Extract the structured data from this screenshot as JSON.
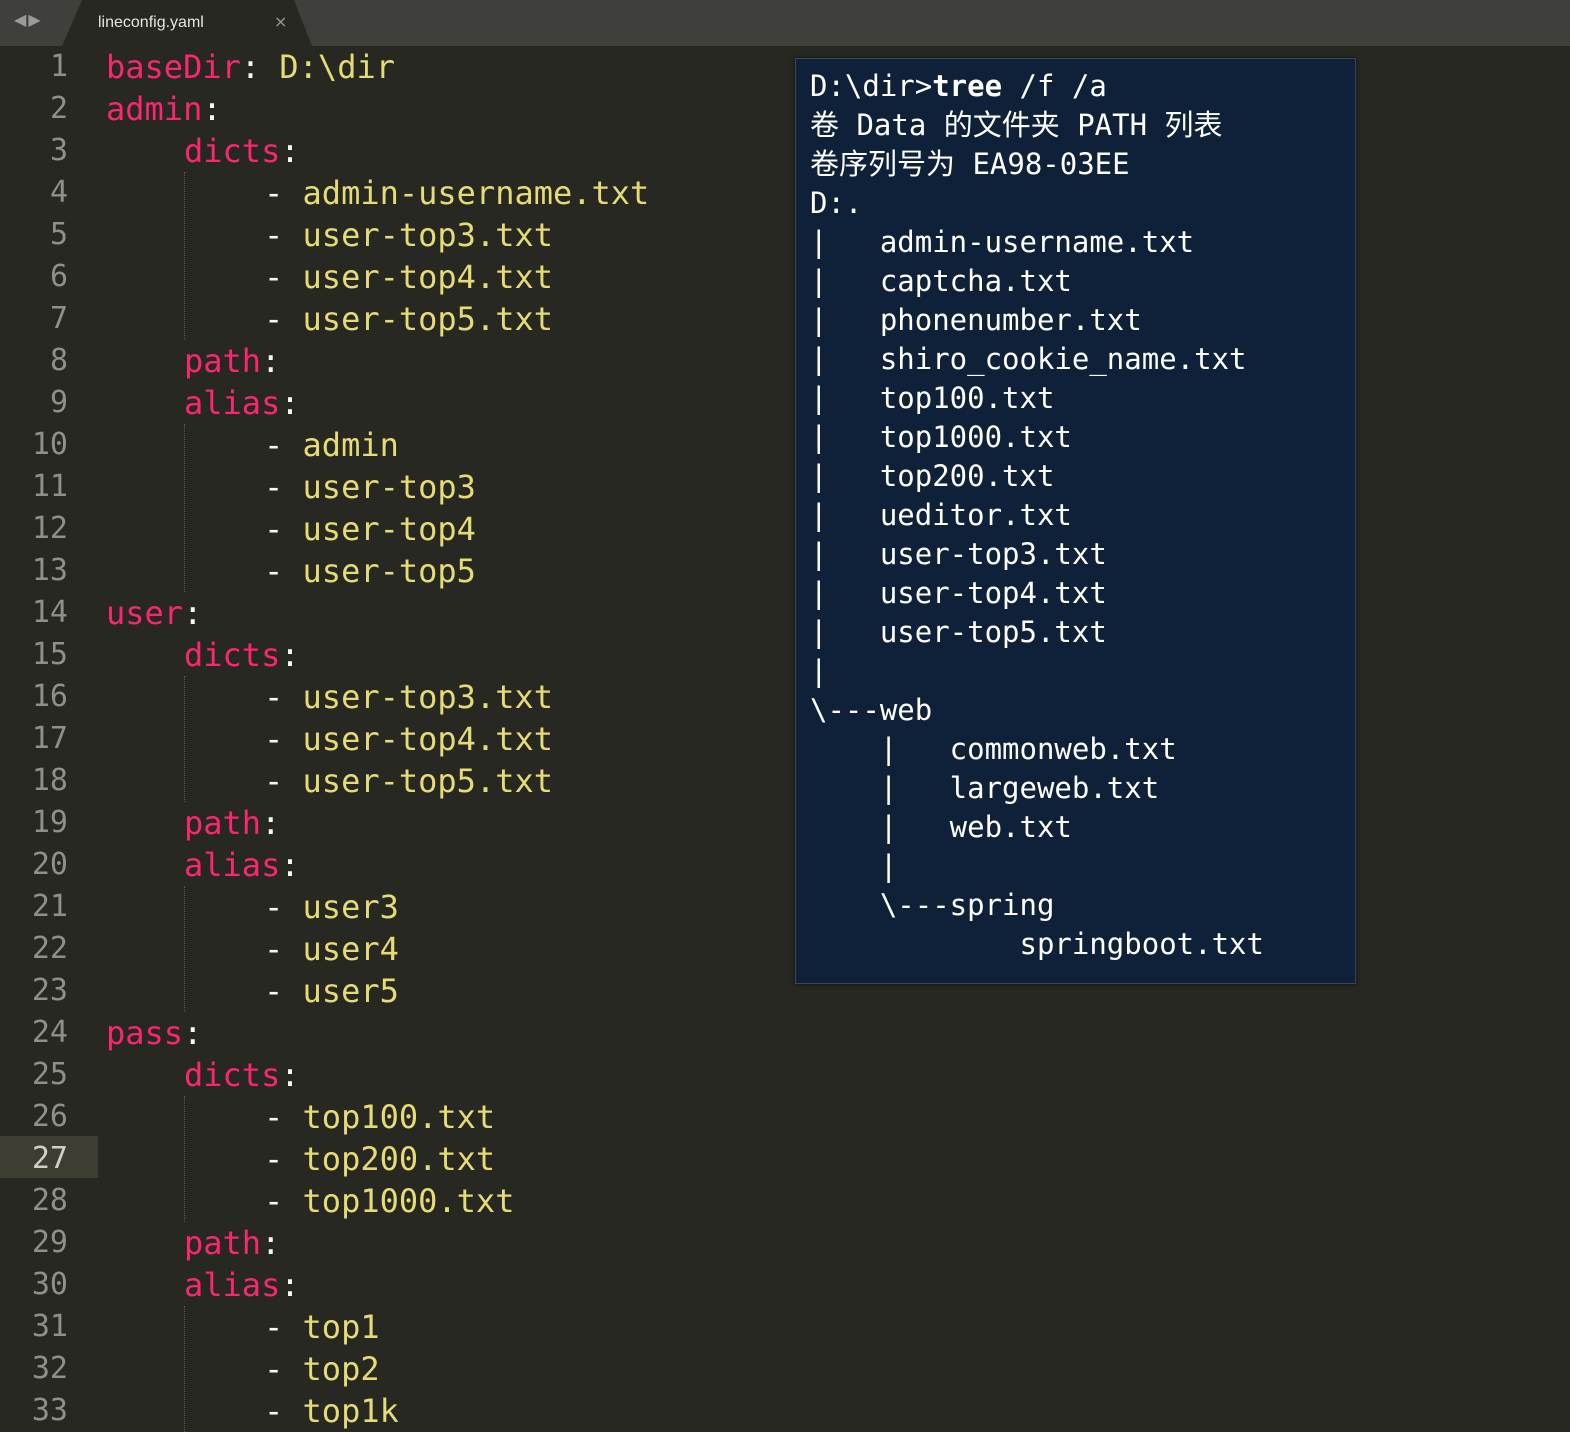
{
  "tabbar": {
    "back_icon": "chevron-left-icon",
    "forward_icon": "chevron-right-icon",
    "back_glyph": "◀",
    "forward_glyph": "▶",
    "tab_title": "lineconfig.yaml",
    "close_glyph": "×"
  },
  "editor": {
    "current_line": 27,
    "line_numbers": [
      "1",
      "2",
      "3",
      "4",
      "5",
      "6",
      "7",
      "8",
      "9",
      "10",
      "11",
      "12",
      "13",
      "14",
      "15",
      "16",
      "17",
      "18",
      "19",
      "20",
      "21",
      "22",
      "23",
      "24",
      "25",
      "26",
      "27",
      "28",
      "29",
      "30",
      "31",
      "32",
      "33"
    ],
    "lines": [
      {
        "indent": 0,
        "key": "baseDir",
        "colon": ":",
        "value": " D:\\dir"
      },
      {
        "indent": 0,
        "key": "admin",
        "colon": ":"
      },
      {
        "indent": 1,
        "key": "dicts",
        "colon": ":"
      },
      {
        "indent": 2,
        "dash": "- ",
        "value": "admin-username.txt"
      },
      {
        "indent": 2,
        "dash": "- ",
        "value": "user-top3.txt"
      },
      {
        "indent": 2,
        "dash": "- ",
        "value": "user-top4.txt"
      },
      {
        "indent": 2,
        "dash": "- ",
        "value": "user-top5.txt"
      },
      {
        "indent": 1,
        "key": "path",
        "colon": ":"
      },
      {
        "indent": 1,
        "key": "alias",
        "colon": ":"
      },
      {
        "indent": 2,
        "dash": "- ",
        "value": "admin"
      },
      {
        "indent": 2,
        "dash": "- ",
        "value": "user-top3"
      },
      {
        "indent": 2,
        "dash": "- ",
        "value": "user-top4"
      },
      {
        "indent": 2,
        "dash": "- ",
        "value": "user-top5"
      },
      {
        "indent": 0,
        "key": "user",
        "colon": ":"
      },
      {
        "indent": 1,
        "key": "dicts",
        "colon": ":"
      },
      {
        "indent": 2,
        "dash": "- ",
        "value": "user-top3.txt"
      },
      {
        "indent": 2,
        "dash": "- ",
        "value": "user-top4.txt"
      },
      {
        "indent": 2,
        "dash": "- ",
        "value": "user-top5.txt"
      },
      {
        "indent": 1,
        "key": "path",
        "colon": ":"
      },
      {
        "indent": 1,
        "key": "alias",
        "colon": ":"
      },
      {
        "indent": 2,
        "dash": "- ",
        "value": "user3"
      },
      {
        "indent": 2,
        "dash": "- ",
        "value": "user4"
      },
      {
        "indent": 2,
        "dash": "- ",
        "value": "user5"
      },
      {
        "indent": 0,
        "key": "pass",
        "colon": ":"
      },
      {
        "indent": 1,
        "key": "dicts",
        "colon": ":"
      },
      {
        "indent": 2,
        "dash": "- ",
        "value": "top100.txt"
      },
      {
        "indent": 2,
        "dash": "- ",
        "value": "top200.txt"
      },
      {
        "indent": 2,
        "dash": "- ",
        "value": "top1000.txt"
      },
      {
        "indent": 1,
        "key": "path",
        "colon": ":"
      },
      {
        "indent": 1,
        "key": "alias",
        "colon": ":"
      },
      {
        "indent": 2,
        "dash": "- ",
        "value": "top1"
      },
      {
        "indent": 2,
        "dash": "- ",
        "value": "top2"
      },
      {
        "indent": 2,
        "dash": "- ",
        "value": "top1k"
      }
    ]
  },
  "terminal": {
    "prompt": "D:\\dir>",
    "command": "tree",
    "args": " /f /a",
    "lines": [
      "卷 Data 的文件夹 PATH 列表",
      "卷序列号为 EA98-03EE",
      "D:.",
      "|   admin-username.txt",
      "|   captcha.txt",
      "|   phonenumber.txt",
      "|   shiro_cookie_name.txt",
      "|   top100.txt",
      "|   top1000.txt",
      "|   top200.txt",
      "|   ueditor.txt",
      "|   user-top3.txt",
      "|   user-top4.txt",
      "|   user-top5.txt",
      "|",
      "\\---web",
      "    |   commonweb.txt",
      "    |   largeweb.txt",
      "    |   web.txt",
      "    |",
      "    \\---spring",
      "            springboot.txt"
    ]
  },
  "colors": {
    "editor_bg": "#272822",
    "key": "#f92672",
    "value": "#e6db74",
    "text": "#f8f8f2",
    "gutter_text": "#90908a",
    "terminal_bg": "#0f2139"
  }
}
